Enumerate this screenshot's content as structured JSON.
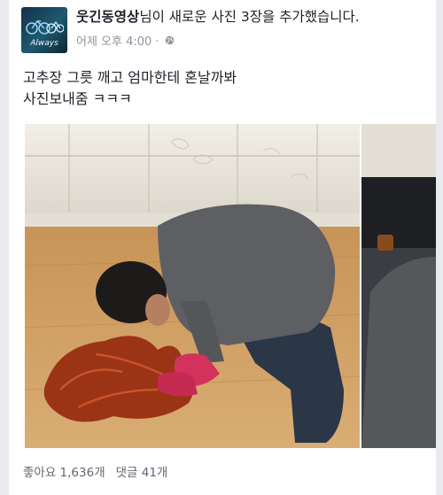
{
  "post": {
    "author": "웃긴동영상",
    "action_text": "님이 새로운 사진 3장을 추가했습니다.",
    "avatar_text": "Always",
    "timestamp": "어제 오후 4:00 · ",
    "audience_icon": "globe-icon",
    "body_lines": [
      "고추장 그릇 깨고 엄마한테 혼날까봐",
      " 사진보내줌 ㅋㅋㅋ"
    ],
    "photos": [
      "man kneeling on wooden floor wiping spilled red pepper paste with pink rubber gloves",
      "second photo partially visible"
    ]
  },
  "reactions": {
    "likes": "좋아요 1,636개",
    "comments": "댓글 41개"
  }
}
